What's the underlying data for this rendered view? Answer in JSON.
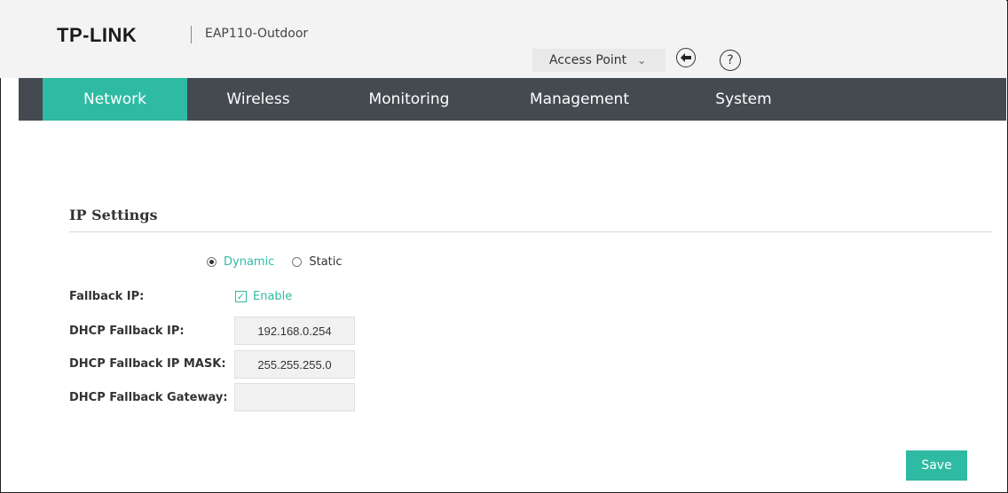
{
  "header": {
    "brand": "TP-LINK",
    "model": "EAP110-Outdoor",
    "mode_selector": "Access Point",
    "icons": {
      "logout": "logout-icon",
      "help": "help-icon",
      "chevron": "chevron-down-icon"
    }
  },
  "nav": {
    "tabs": [
      {
        "label": "Network",
        "active": true
      },
      {
        "label": "Wireless",
        "active": false
      },
      {
        "label": "Monitoring",
        "active": false
      },
      {
        "label": "Management",
        "active": false
      },
      {
        "label": "System",
        "active": false
      }
    ]
  },
  "ip_settings": {
    "title": "IP Settings",
    "mode_options": [
      {
        "label": "Dynamic",
        "selected": true
      },
      {
        "label": "Static",
        "selected": false
      }
    ],
    "fallback_ip": {
      "label": "Fallback IP:",
      "checkbox_label": "Enable",
      "checked": true
    },
    "fields": [
      {
        "label": "DHCP Fallback IP:",
        "value": "192.168.0.254"
      },
      {
        "label": "DHCP Fallback IP MASK:",
        "value": "255.255.255.0"
      },
      {
        "label": "DHCP Fallback Gateway:",
        "value": ""
      }
    ]
  },
  "actions": {
    "save_label": "Save"
  },
  "colors": {
    "accent": "#2ebaa3",
    "navbar": "#444a50",
    "header_bg": "#f3f3f3"
  }
}
